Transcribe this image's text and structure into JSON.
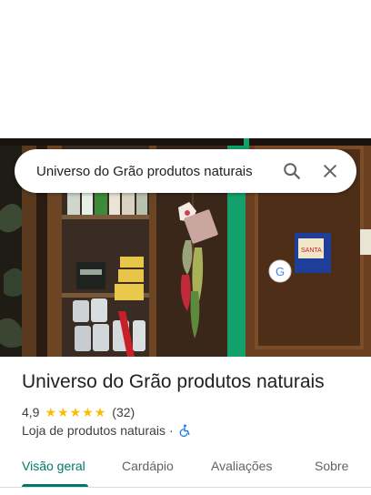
{
  "search": {
    "query": "Universo do Grão produtos naturais"
  },
  "place": {
    "name": "Universo do Grão produtos naturais",
    "rating": "4,9",
    "stars": 5,
    "review_count": "(32)",
    "category": "Loja de produtos naturais",
    "separator": "·"
  },
  "tabs": [
    {
      "label": "Visão geral",
      "active": true
    },
    {
      "label": "Cardápio",
      "active": false
    },
    {
      "label": "Avaliações",
      "active": false
    },
    {
      "label": "Sobre",
      "active": false
    }
  ],
  "photo": {
    "sign_text": "SANTA LUZ",
    "sticker_text": "G"
  },
  "colors": {
    "accent": "#00796b",
    "star": "#fbbc04",
    "wheelchair": "#1a73e8"
  }
}
